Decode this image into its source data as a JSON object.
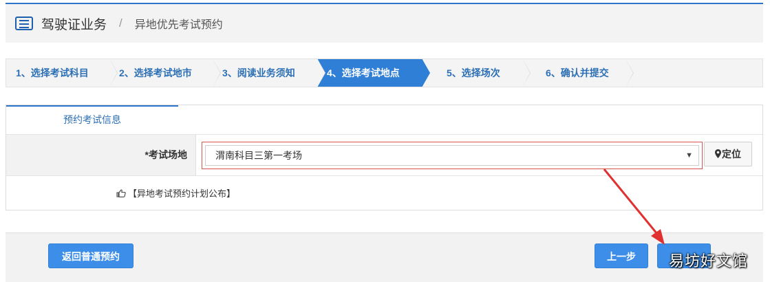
{
  "header": {
    "title": "驾驶证业务",
    "separator": "/",
    "subtitle": "异地优先考试预约"
  },
  "steps": [
    {
      "label": "1、选择考试科目"
    },
    {
      "label": "2、选择考试地市"
    },
    {
      "label": "3、阅读业务须知"
    },
    {
      "label": "4、选择考试地点",
      "active": true
    },
    {
      "label": "5、选择场次"
    },
    {
      "label": "6、确认并提交"
    }
  ],
  "panel": {
    "tab_label": "预约考试信息",
    "field_label": "*考试场地",
    "select_value": "渭南科目三第一考场",
    "caret": "▼",
    "locate_label": "定位",
    "plan_link": "【异地考试预约计划公布】"
  },
  "footer": {
    "back_label": "返回普通预约",
    "prev_label": "上一步",
    "next_label": ""
  },
  "watermark": "易坊好文馆",
  "colors": {
    "accent": "#2f7fd6",
    "annotation_arrow": "#e03030"
  }
}
